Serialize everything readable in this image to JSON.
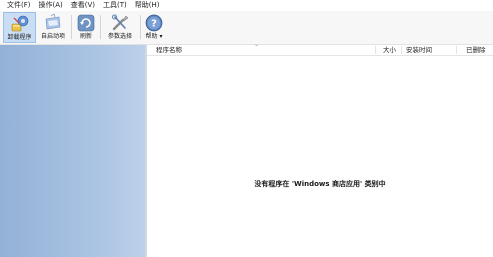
{
  "menu": [
    {
      "label": "文件(F)"
    },
    {
      "label": "操作(A)"
    },
    {
      "label": "查看(V)"
    },
    {
      "label": "工具(T)"
    },
    {
      "label": "帮助(H)"
    }
  ],
  "toolbar": {
    "uninstall_label": "卸载程序",
    "startup_label": "自启动项",
    "refresh_label": "刷新",
    "settings_label": "参数选择",
    "help_label": "帮助 ▾",
    "selected": "uninstall"
  },
  "list": {
    "columns": [
      "程序名称",
      "大小",
      "安装时间",
      "已删除"
    ],
    "rows": [],
    "empty_message": "没有程序在 'Windows 商店应用' 类别中"
  },
  "colors": {
    "sidebar_start": "#93b1d6",
    "sidebar_end": "#bcd0ea",
    "toolbar_selected": "#c9def5"
  },
  "icons": {
    "uninstall": "uninstall-programs-icon",
    "startup": "startup-items-icon",
    "refresh": "refresh-icon",
    "settings": "settings-tools-icon",
    "help": "help-question-icon"
  }
}
